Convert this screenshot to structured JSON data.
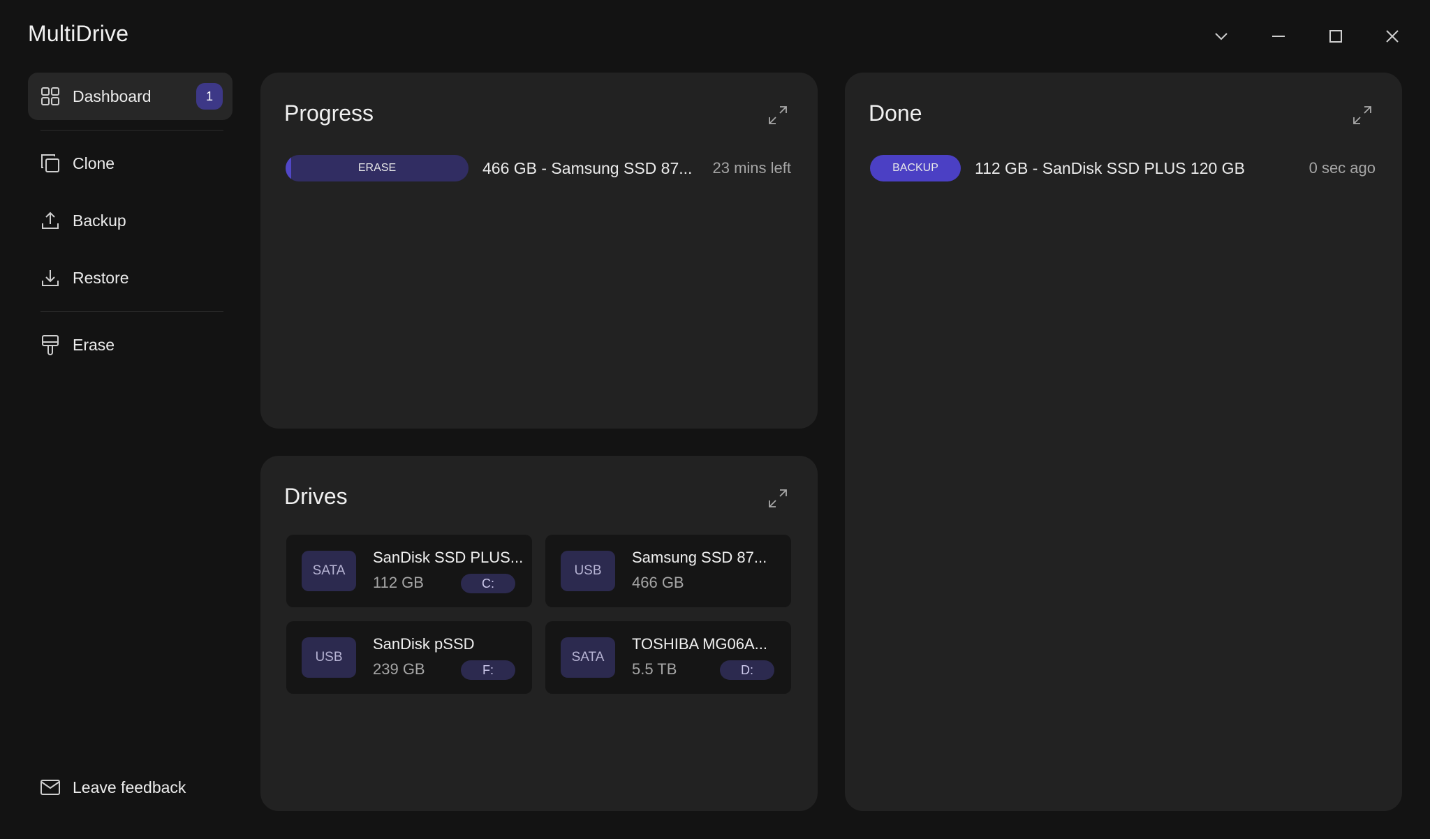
{
  "app": {
    "title": "MultiDrive"
  },
  "sidebar": {
    "items": [
      {
        "label": "Dashboard",
        "badge": "1"
      },
      {
        "label": "Clone"
      },
      {
        "label": "Backup"
      },
      {
        "label": "Restore"
      },
      {
        "label": "Erase"
      }
    ],
    "feedback_label": "Leave feedback"
  },
  "progress": {
    "title": "Progress",
    "jobs": [
      {
        "tag": "ERASE",
        "description": "466 GB - Samsung SSD 87...",
        "time": "23 mins left",
        "progress_fraction": 0.03
      }
    ]
  },
  "done": {
    "title": "Done",
    "jobs": [
      {
        "tag": "BACKUP",
        "description": "112 GB - SanDisk SSD PLUS 120 GB",
        "time": "0 sec ago"
      }
    ]
  },
  "drives": {
    "title": "Drives",
    "items": [
      {
        "interface": "SATA",
        "name": "SanDisk SSD PLUS...",
        "size": "112 GB",
        "letter": "C:"
      },
      {
        "interface": "USB",
        "name": "Samsung SSD 87...",
        "size": "466 GB",
        "letter": ""
      },
      {
        "interface": "USB",
        "name": "SanDisk pSSD",
        "size": "239 GB",
        "letter": "F:"
      },
      {
        "interface": "SATA",
        "name": "TOSHIBA MG06A...",
        "size": "5.5 TB",
        "letter": "D:"
      }
    ]
  },
  "colors": {
    "background": "#131313",
    "panel": "#222222",
    "accent": "#4b40c4",
    "accent_dark": "#312d62",
    "drive_card": "#151515"
  }
}
